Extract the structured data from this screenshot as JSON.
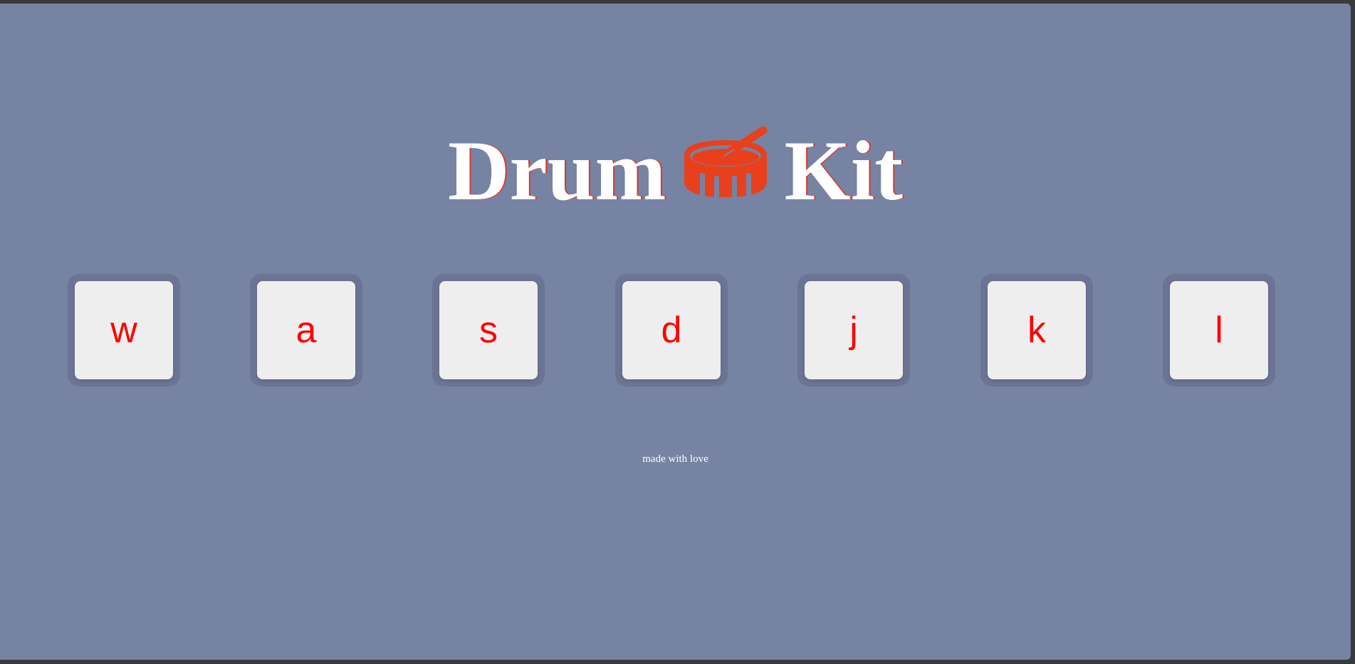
{
  "header": {
    "title_left": "Drum",
    "title_right": "Kit",
    "icon": "drum-icon"
  },
  "drums": [
    {
      "key": "w"
    },
    {
      "key": "a"
    },
    {
      "key": "s"
    },
    {
      "key": "d"
    },
    {
      "key": "j"
    },
    {
      "key": "k"
    },
    {
      "key": "l"
    }
  ],
  "footer": {
    "text": "made with love"
  },
  "colors": {
    "background": "#7783a2",
    "key_background": "#eeeeee",
    "key_text": "#ff0000",
    "title_text": "#ffffff",
    "icon": "#e8401c"
  }
}
